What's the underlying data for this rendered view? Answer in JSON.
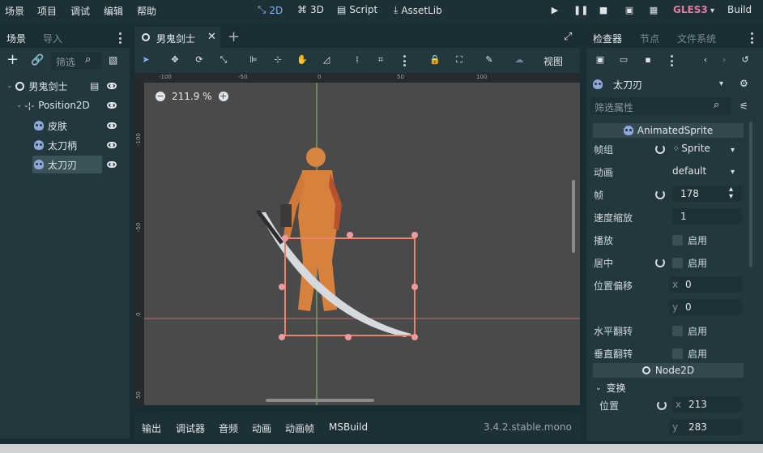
{
  "menu": [
    "场景",
    "项目",
    "调试",
    "编辑",
    "帮助"
  ],
  "workspaces": [
    {
      "label": "2D",
      "active": true
    },
    {
      "label": "3D",
      "active": false
    },
    {
      "label": "Script",
      "active": false
    },
    {
      "label": "AssetLib",
      "active": false
    }
  ],
  "renderer": "GLES3",
  "build_label": "Build",
  "scene_panel": {
    "tabs": [
      "场景",
      "导入"
    ],
    "filter_placeholder": "筛选",
    "tree": [
      {
        "label": "男鬼剑士",
        "icon": "node-circle-icon",
        "level": 0
      },
      {
        "label": "Position2D",
        "icon": "position2d-icon",
        "level": 1
      },
      {
        "label": "皮肤",
        "icon": "sprite-icon",
        "level": 2
      },
      {
        "label": "太刀柄",
        "icon": "sprite-icon",
        "level": 2
      },
      {
        "label": "太刀刃",
        "icon": "sprite-icon",
        "level": 2,
        "selected": true
      }
    ]
  },
  "editor_tab": {
    "label": "男鬼剑士"
  },
  "toolbar": {
    "view_label": "视图"
  },
  "viewport": {
    "zoom": "211.9 %"
  },
  "ruler_h": [
    "-100",
    "-50",
    "0",
    "50",
    "100"
  ],
  "ruler_v": [
    "-100",
    "-50",
    "0",
    "50"
  ],
  "bottom_tabs": [
    "输出",
    "调试器",
    "音频",
    "动画",
    "动画帧",
    "MSBuild"
  ],
  "version": "3.4.2.stable.mono",
  "inspector": {
    "tabs": [
      "检查器",
      "节点",
      "文件系统"
    ],
    "object_name": "太刀刃",
    "filter_placeholder": "筛选属性",
    "class_section": "AnimatedSprite",
    "props": {
      "frames_label": "帧组",
      "frames_value": "Sprite",
      "animation_label": "动画",
      "animation_value": "default",
      "frame_label": "帧",
      "frame_value": "178",
      "speed_label": "速度缩放",
      "speed_value": "1",
      "playing_label": "播放",
      "playing_value": "启用",
      "centered_label": "居中",
      "centered_value": "启用",
      "offset_label": "位置偏移",
      "offset_x": "0",
      "offset_y": "0",
      "flip_h_label": "水平翻转",
      "flip_h_value": "启用",
      "flip_v_label": "垂直翻转",
      "flip_v_value": "启用"
    },
    "node2d_section": "Node2D",
    "transform_label": "变换",
    "position_label": "位置",
    "position_x": "213",
    "position_y": "283"
  },
  "colors": {
    "accent": "#7fb4ff",
    "gles": "#e57ba0",
    "selection": "#e8836a"
  }
}
